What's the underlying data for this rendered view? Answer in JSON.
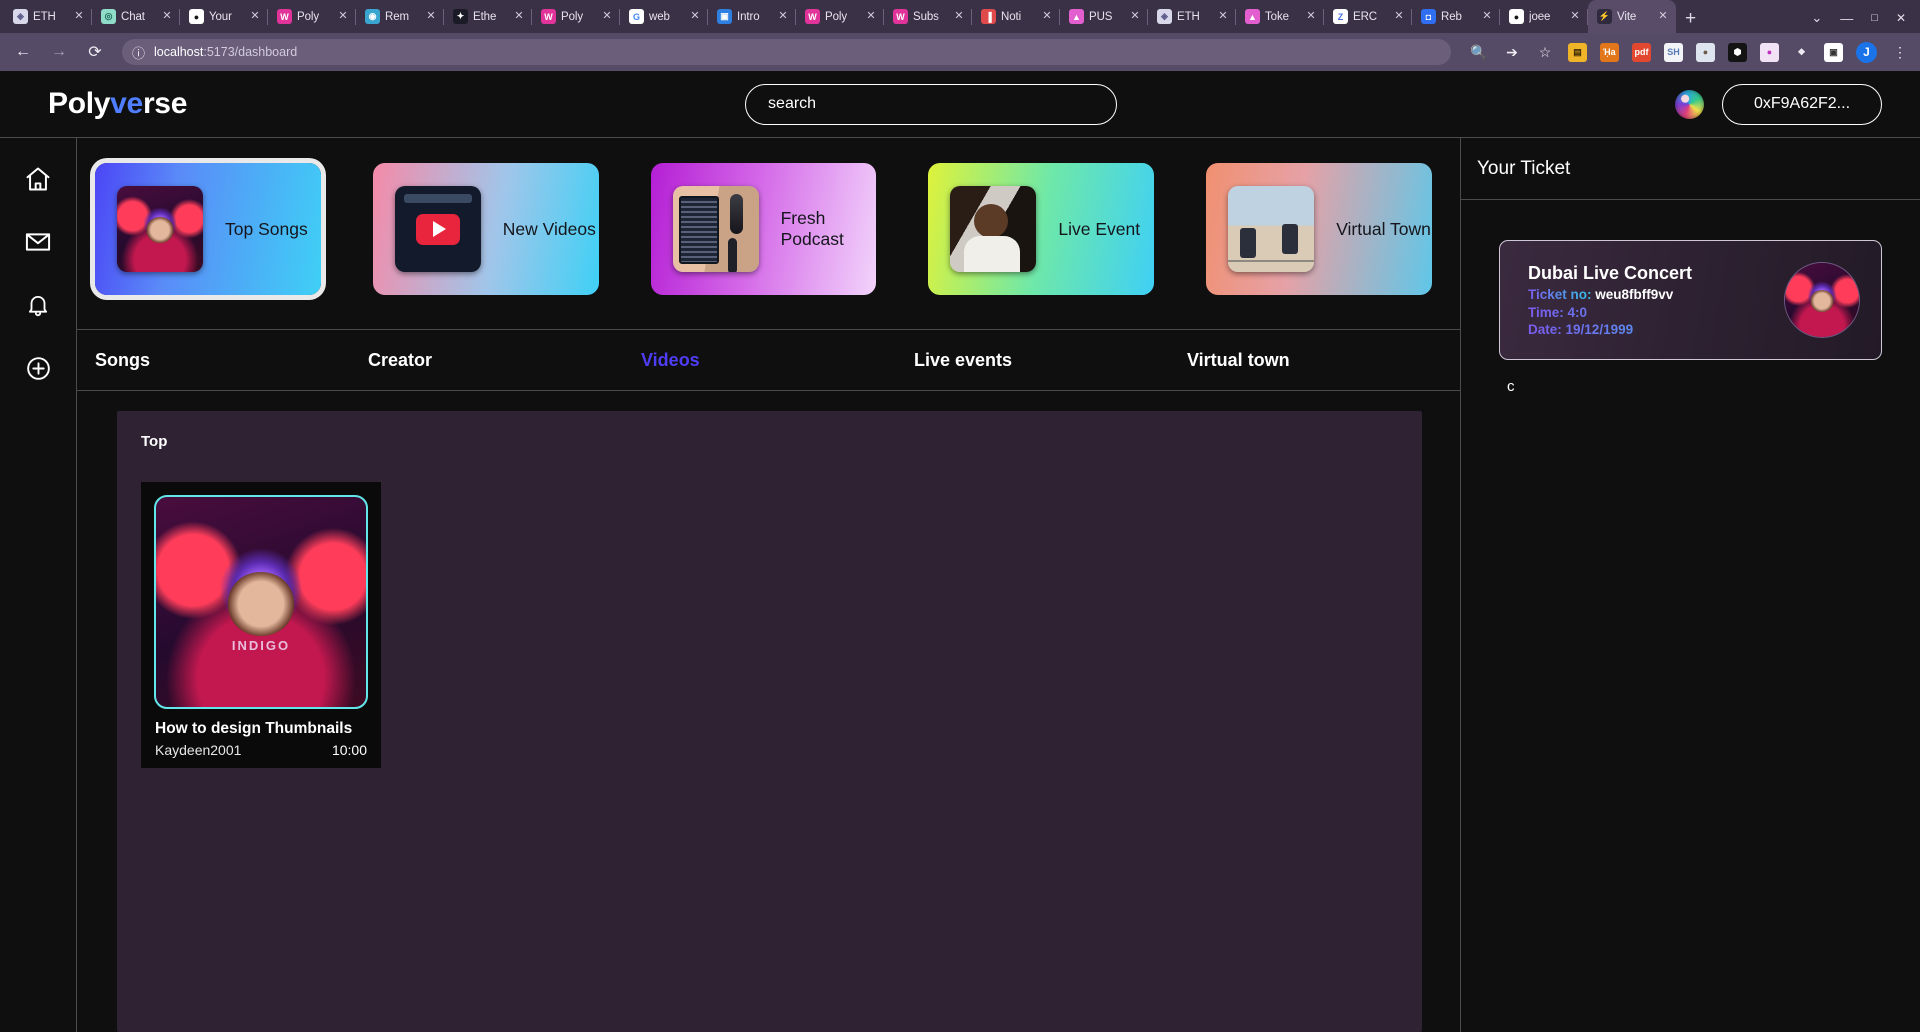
{
  "browser": {
    "tabs": [
      {
        "title": "ETH",
        "fav": "eth",
        "color": "#cfcfe6"
      },
      {
        "title": "Chat",
        "fav": "chat",
        "color": "#7fd4c4"
      },
      {
        "title": "Your",
        "fav": "github",
        "color": "#ffffff"
      },
      {
        "title": "Poly",
        "fav": "poly",
        "color": "#e0349b"
      },
      {
        "title": "Rem",
        "fav": "remix",
        "color": "#3aa6d0"
      },
      {
        "title": "Ethe",
        "fav": "ethers",
        "color": "#dddde8"
      },
      {
        "title": "Poly",
        "fav": "poly",
        "color": "#e0349b"
      },
      {
        "title": "web",
        "fav": "google",
        "color": "#ffffff"
      },
      {
        "title": "Intro",
        "fav": "video",
        "color": "#2f7fe0"
      },
      {
        "title": "Poly",
        "fav": "poly",
        "color": "#e0349b"
      },
      {
        "title": "Subs",
        "fav": "poly",
        "color": "#e0349b"
      },
      {
        "title": "Noti",
        "fav": "bar",
        "color": "#e04a4a"
      },
      {
        "title": "PUS",
        "fav": "push",
        "color": "#e35fd0"
      },
      {
        "title": "ETH",
        "fav": "eth",
        "color": "#cfcfe6"
      },
      {
        "title": "Toke",
        "fav": "push",
        "color": "#e35fd0"
      },
      {
        "title": "ERC",
        "fav": "zed",
        "color": "#ffffff"
      },
      {
        "title": "Reb",
        "fav": "blue",
        "color": "#2f6ef0"
      },
      {
        "title": "joee",
        "fav": "github",
        "color": "#ffffff"
      },
      {
        "title": "Vite",
        "fav": "vite",
        "color": "#41c7d8"
      }
    ],
    "newtab_label": "+",
    "window_controls": [
      "⌄",
      "–",
      "☐",
      "✕"
    ],
    "back_label": "←",
    "forward_label": "→",
    "reload_label": "⟳",
    "site_info_label": "ⓘ",
    "url_host": "localhost",
    "url_path": ":5173/dashboard",
    "toolbar_icons": [
      "zoom-icon",
      "share-icon",
      "star-icon"
    ],
    "extensions": [
      {
        "name": "wallet-extension",
        "glyph": "▤",
        "bg": "#f0b429",
        "fg": "#3b2b05"
      },
      {
        "name": "metamask-extension",
        "glyph": "ᾘa",
        "bg": "#e2761b",
        "fg": "#ffffff"
      },
      {
        "name": "pdf-extension",
        "glyph": "pdf",
        "bg": "#e2472f",
        "fg": "#ffffff",
        "badge": "off"
      },
      {
        "name": "sh-extension",
        "glyph": "SH",
        "bg": "#f2f4f8",
        "fg": "#5b7ab5"
      },
      {
        "name": "profile-extension",
        "glyph": "●",
        "bg": "#dfe5ef",
        "fg": "#6b5d4a"
      },
      {
        "name": "hex-extension",
        "glyph": "⬢",
        "bg": "#141414",
        "fg": "#ffffff"
      },
      {
        "name": "push-extension",
        "glyph": "●",
        "bg": "#f2e2f6",
        "fg": "#c032c0"
      },
      {
        "name": "puzzle-extension",
        "glyph": "❖",
        "bg": "transparent",
        "fg": "#f1eef6"
      },
      {
        "name": "sidepanel-extension",
        "glyph": "▣",
        "bg": "#ffffff",
        "fg": "#333333"
      }
    ],
    "profile_initial": "J",
    "menu_label": "⋮"
  },
  "app": {
    "logo": {
      "part1": "Poly",
      "part2": "ve",
      "part3": "rse"
    },
    "search": {
      "placeholder": "search",
      "value": ""
    },
    "wallet_label": "0xF9A62F2...",
    "sidebar": [
      {
        "name": "home-icon",
        "label": "Home"
      },
      {
        "name": "mail-icon",
        "label": "Mail"
      },
      {
        "name": "bell-icon",
        "label": "Notifications"
      },
      {
        "name": "plus-circle-icon",
        "label": "Create"
      }
    ],
    "cards": [
      {
        "label": "Top Songs",
        "gradient": "linear-gradient(100deg, #4b46f5 0%, #5a8bf8 35%, #3fd0f5 100%)",
        "thumb": "th-indigo",
        "selected": true
      },
      {
        "label": "New Videos",
        "gradient": "linear-gradient(100deg, #f58aa8 0%, #9fc6ea 55%, #3fd0f5 100%)",
        "thumb": "th-yt",
        "selected": false
      },
      {
        "label": "Fresh Podcast",
        "gradient": "linear-gradient(100deg, #b41fd4 0%, #d468e8 45%, #f2d4fb 100%)",
        "thumb": "th-pod",
        "selected": false
      },
      {
        "label": "Live Event",
        "gradient": "linear-gradient(100deg, #dff23a 0%, #6fe8a8 50%, #3fd0f5 100%)",
        "thumb": "th-live",
        "selected": false
      },
      {
        "label": "Virtual Town",
        "gradient": "linear-gradient(100deg, #f09070 0%, #e6a1a6 40%, #5fc7e8 100%)",
        "thumb": "th-town",
        "selected": false
      }
    ],
    "tabs": [
      {
        "label": "Songs",
        "active": false
      },
      {
        "label": "Creator",
        "active": false
      },
      {
        "label": "Videos",
        "active": true
      },
      {
        "label": "Live events",
        "active": false
      },
      {
        "label": "Virtual town",
        "active": false
      }
    ],
    "listing": {
      "title": "Top",
      "videos": [
        {
          "title": "How to design Thumbnails",
          "channel": "Kaydeen2001",
          "duration": "10:00",
          "thumb_label": "INDIGO"
        }
      ]
    },
    "rail": {
      "heading": "Your Ticket",
      "stray_char": "c",
      "ticket": {
        "event": "Dubai Live Concert",
        "ticket_no_label": "Ticket no:",
        "ticket_no": "weu8fbff9vv",
        "time_label": "Time:",
        "time": "4:0",
        "date_label": "Date:",
        "date": "19/12/1999"
      }
    },
    "colors": {
      "bg": "#0f0f0f",
      "accent": "#4f3df5",
      "logo_accent": "#4f7fff",
      "panel": "#2e2233",
      "thumb_outline": "#62e6ea"
    }
  }
}
